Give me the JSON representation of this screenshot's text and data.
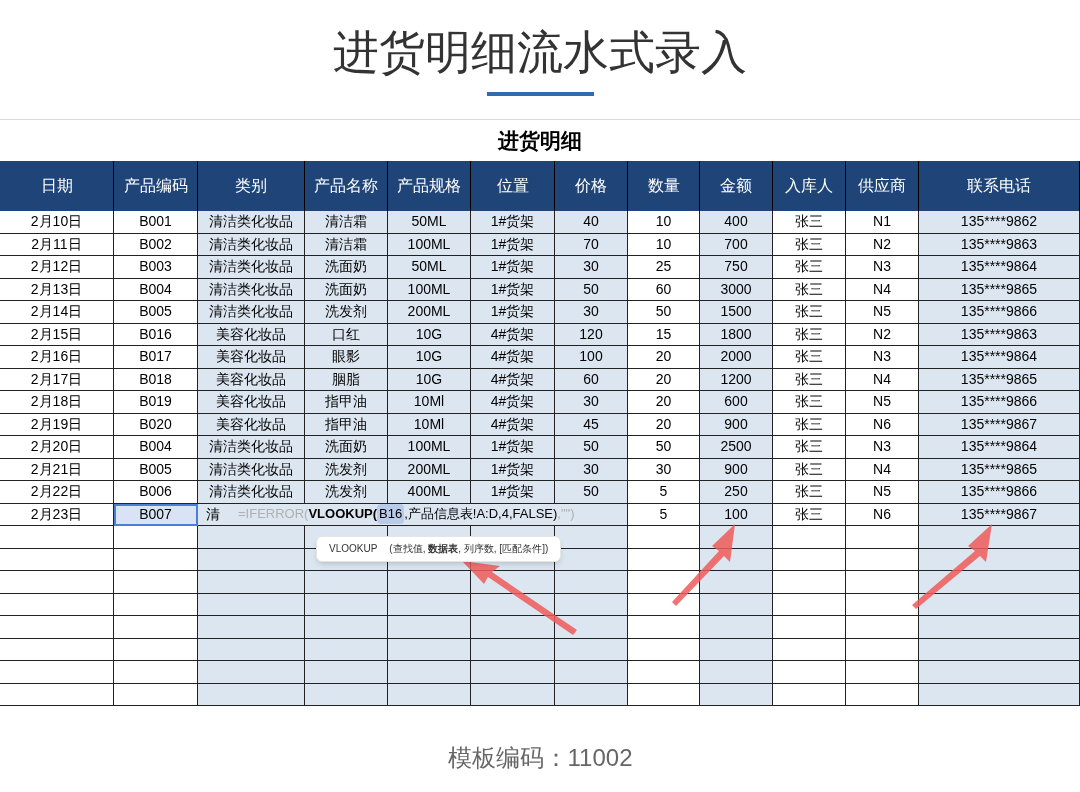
{
  "page_title": "进货明细流水式录入",
  "sheet": {
    "title": "进货明细",
    "columns": [
      {
        "label": "日期",
        "shaded": false
      },
      {
        "label": "产品编码",
        "shaded": false
      },
      {
        "label": "类别",
        "shaded": true
      },
      {
        "label": "产品名称",
        "shaded": true
      },
      {
        "label": "产品规格",
        "shaded": true
      },
      {
        "label": "位置",
        "shaded": true
      },
      {
        "label": "价格",
        "shaded": true
      },
      {
        "label": "数量",
        "shaded": false
      },
      {
        "label": "金额",
        "shaded": true
      },
      {
        "label": "入库人",
        "shaded": false
      },
      {
        "label": "供应商",
        "shaded": false
      },
      {
        "label": "联系电话",
        "shaded": true
      }
    ],
    "rows": [
      [
        "2月10日",
        "B001",
        "清洁类化妆品",
        "清洁霜",
        "50ML",
        "1#货架",
        "40",
        "10",
        "400",
        "张三",
        "N1",
        "135****9862"
      ],
      [
        "2月11日",
        "B002",
        "清洁类化妆品",
        "清洁霜",
        "100ML",
        "1#货架",
        "70",
        "10",
        "700",
        "张三",
        "N2",
        "135****9863"
      ],
      [
        "2月12日",
        "B003",
        "清洁类化妆品",
        "洗面奶",
        "50ML",
        "1#货架",
        "30",
        "25",
        "750",
        "张三",
        "N3",
        "135****9864"
      ],
      [
        "2月13日",
        "B004",
        "清洁类化妆品",
        "洗面奶",
        "100ML",
        "1#货架",
        "50",
        "60",
        "3000",
        "张三",
        "N4",
        "135****9865"
      ],
      [
        "2月14日",
        "B005",
        "清洁类化妆品",
        "洗发剂",
        "200ML",
        "1#货架",
        "30",
        "50",
        "1500",
        "张三",
        "N5",
        "135****9866"
      ],
      [
        "2月15日",
        "B016",
        "美容化妆品",
        "口红",
        "10G",
        "4#货架",
        "120",
        "15",
        "1800",
        "张三",
        "N2",
        "135****9863"
      ],
      [
        "2月16日",
        "B017",
        "美容化妆品",
        "眼影",
        "10G",
        "4#货架",
        "100",
        "20",
        "2000",
        "张三",
        "N3",
        "135****9864"
      ],
      [
        "2月17日",
        "B018",
        "美容化妆品",
        "胭脂",
        "10G",
        "4#货架",
        "60",
        "20",
        "1200",
        "张三",
        "N4",
        "135****9865"
      ],
      [
        "2月18日",
        "B019",
        "美容化妆品",
        "指甲油",
        "10Ml",
        "4#货架",
        "30",
        "20",
        "600",
        "张三",
        "N5",
        "135****9866"
      ],
      [
        "2月19日",
        "B020",
        "美容化妆品",
        "指甲油",
        "10Ml",
        "4#货架",
        "45",
        "20",
        "900",
        "张三",
        "N6",
        "135****9867"
      ],
      [
        "2月20日",
        "B004",
        "清洁类化妆品",
        "洗面奶",
        "100ML",
        "1#货架",
        "50",
        "50",
        "2500",
        "张三",
        "N3",
        "135****9864"
      ],
      [
        "2月21日",
        "B005",
        "清洁类化妆品",
        "洗发剂",
        "200ML",
        "1#货架",
        "30",
        "30",
        "900",
        "张三",
        "N4",
        "135****9865"
      ],
      [
        "2月22日",
        "B006",
        "清洁类化妆品",
        "洗发剂",
        "400ML",
        "1#货架",
        "50",
        "5",
        "250",
        "张三",
        "N5",
        "135****9866"
      ]
    ],
    "editing_row": {
      "date": "2月23日",
      "code": "B007",
      "code_selected": true,
      "category": "清",
      "quantity": "5",
      "amount": "100",
      "receiver": "张三",
      "supplier": "N6",
      "phone": "135****9867",
      "formula": [
        {
          "text": "=IFERROR(",
          "kind": "muted"
        },
        {
          "text": "VLOOKUP(",
          "kind": "bold"
        },
        {
          "text": "B16",
          "kind": "ref"
        },
        {
          "text": ",产品信息表!A:D,4,FALSE)",
          "kind": "plain"
        },
        {
          "text": ",\"\")",
          "kind": "muted"
        }
      ],
      "tooltip": {
        "function": "VLOOKUP",
        "args": "(查找值, **数据表**, 列序数, [匹配条件])"
      }
    }
  },
  "footer": "模板编码：11002"
}
